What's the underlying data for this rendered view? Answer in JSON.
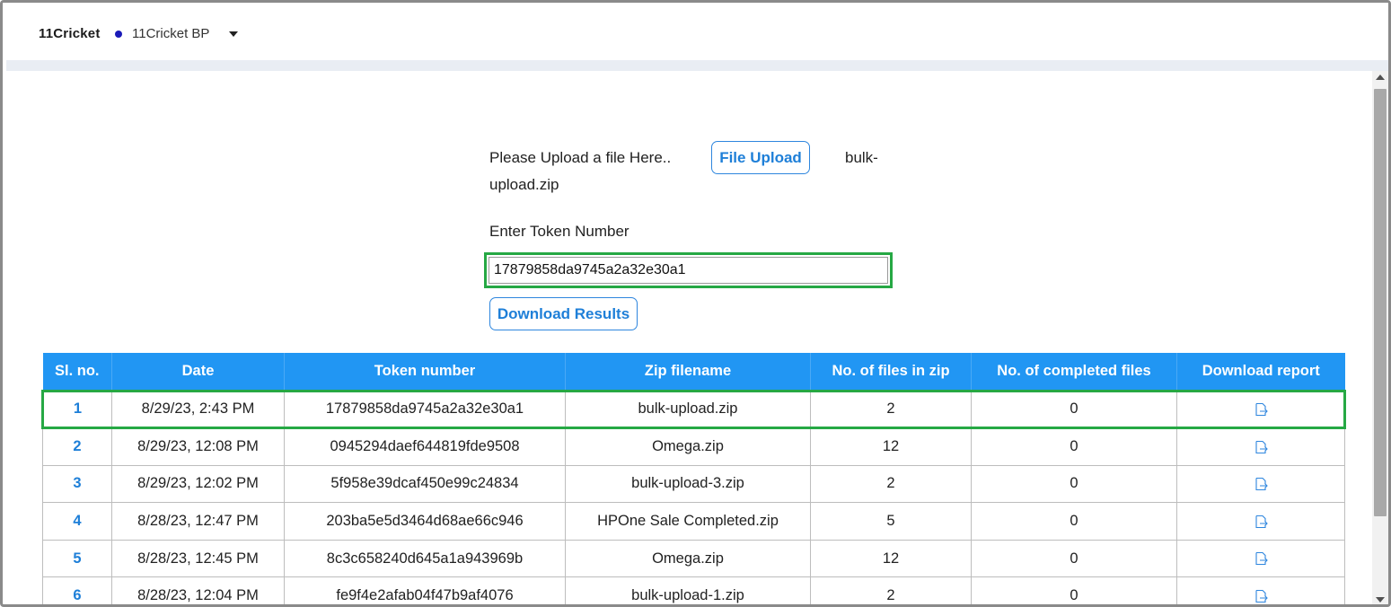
{
  "header": {
    "brand": "11Cricket",
    "org_name": "11Cricket BP"
  },
  "upload": {
    "prompt": "Please Upload a file Here..",
    "button_label": "File Upload",
    "filename_part1": "bulk-",
    "filename_part2": "upload.zip"
  },
  "token": {
    "label": "Enter Token Number",
    "value": "17879858da9745a2a32e30a1"
  },
  "download_button": "Download Results",
  "table": {
    "headers": [
      "Sl. no.",
      "Date",
      "Token number",
      "Zip filename",
      "No. of files in zip",
      "No. of completed files",
      "Download report"
    ],
    "rows": [
      {
        "sl": "1",
        "date": "8/29/23, 2:43 PM",
        "token": "17879858da9745a2a32e30a1",
        "zip": "bulk-upload.zip",
        "files": "2",
        "completed": "0"
      },
      {
        "sl": "2",
        "date": "8/29/23, 12:08 PM",
        "token": "0945294daef644819fde9508",
        "zip": "Omega.zip",
        "files": "12",
        "completed": "0"
      },
      {
        "sl": "3",
        "date": "8/29/23, 12:02 PM",
        "token": "5f958e39dcaf450e99c24834",
        "zip": "bulk-upload-3.zip",
        "files": "2",
        "completed": "0"
      },
      {
        "sl": "4",
        "date": "8/28/23, 12:47 PM",
        "token": "203ba5e5d3464d68ae66c946",
        "zip": "HPOne Sale Completed.zip",
        "files": "5",
        "completed": "0"
      },
      {
        "sl": "5",
        "date": "8/28/23, 12:45 PM",
        "token": "8c3c658240d645a1a943969b",
        "zip": "Omega.zip",
        "files": "12",
        "completed": "0"
      },
      {
        "sl": "6",
        "date": "8/28/23, 12:04 PM",
        "token": "fe9f4e2afab04f47b9af4076",
        "zip": "bulk-upload-1.zip",
        "files": "2",
        "completed": "0"
      }
    ]
  },
  "colors": {
    "accent": "#2196f3",
    "highlight": "#26a844",
    "link": "#1e7fd8"
  }
}
